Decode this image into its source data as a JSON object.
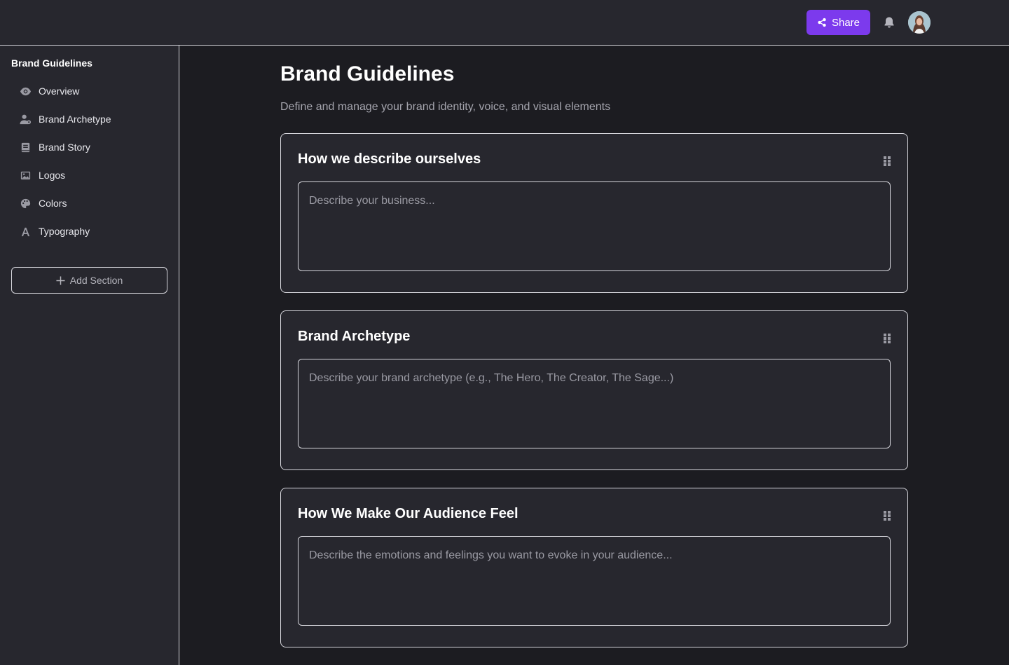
{
  "header": {
    "share_label": "Share"
  },
  "sidebar": {
    "title": "Brand Guidelines",
    "items": [
      {
        "label": "Overview",
        "icon": "eye-icon"
      },
      {
        "label": "Brand Archetype",
        "icon": "user-icon"
      },
      {
        "label": "Brand Story",
        "icon": "book-icon"
      },
      {
        "label": "Logos",
        "icon": "image-icon"
      },
      {
        "label": "Colors",
        "icon": "palette-icon"
      },
      {
        "label": "Typography",
        "icon": "letter-a-icon"
      }
    ],
    "add_section_label": "Add Section"
  },
  "main": {
    "title": "Brand Guidelines",
    "subtitle": "Define and manage your brand identity, voice, and visual elements",
    "sections": [
      {
        "title": "How we describe ourselves",
        "placeholder": "Describe your business..."
      },
      {
        "title": "Brand Archetype",
        "placeholder": "Describe your brand archetype (e.g., The Hero, The Creator, The Sage...)"
      },
      {
        "title": "How We Make Our Audience Feel",
        "placeholder": "Describe the emotions and feelings you want to evoke in your audience..."
      }
    ]
  },
  "colors": {
    "accent": "#7c3aed",
    "background": "#1c1c21",
    "panel": "#27272e",
    "border": "#d6d6dc"
  }
}
